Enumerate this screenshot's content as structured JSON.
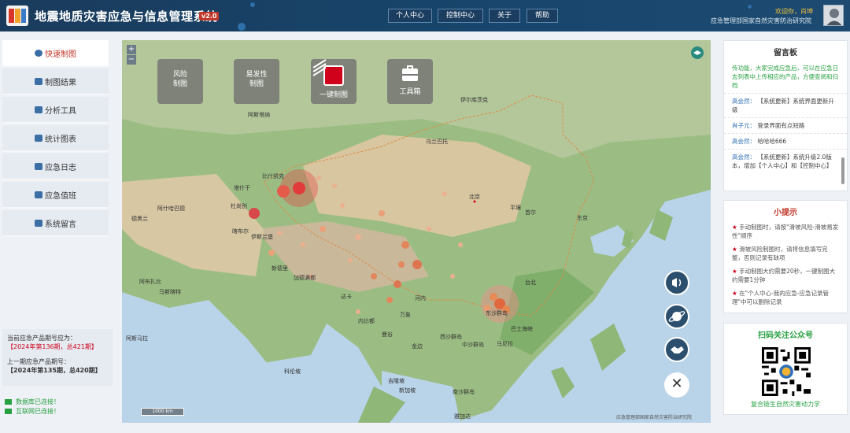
{
  "header": {
    "title": "地震地质灾害应急与信息管理系统",
    "version": "v2.0",
    "nav": [
      "个人中心",
      "控制中心",
      "关于",
      "帮助"
    ],
    "welcome": "欢迎你，肖坤",
    "org": "应急管理部国家自然灾害防治研究院"
  },
  "sidebar": {
    "items": [
      {
        "label": "快速制图",
        "active": true
      },
      {
        "label": "制图结果"
      },
      {
        "label": "分析工具"
      },
      {
        "label": "统计图表"
      },
      {
        "label": "应急日志"
      },
      {
        "label": "应急值班"
      },
      {
        "label": "系统留言"
      }
    ],
    "current_label": "当前应急产品期号应为：",
    "current_value": "【2024年第136期，总421期】",
    "previous_label": "上一期应急产品期号：",
    "previous_value": "【2024年第135期，总420期】",
    "status": [
      "数据库已连接！",
      "互联网已连接！"
    ]
  },
  "map": {
    "tools": [
      {
        "label": "风险\n制图",
        "icon": ""
      },
      {
        "label": "易发性\n制图",
        "icon": ""
      },
      {
        "label": "一键制图",
        "icon": "flag-icon"
      },
      {
        "label": "工具箱",
        "icon": "toolbox-icon"
      }
    ],
    "labels": [
      {
        "text": "阿斯塔纳",
        "name": "astana"
      },
      {
        "text": "比什凯克",
        "name": "bishkek"
      },
      {
        "text": "塔什干",
        "name": "tashkent"
      },
      {
        "text": "杜尚别",
        "name": "dushanbe"
      },
      {
        "text": "喀布尔",
        "name": "kabul"
      },
      {
        "text": "伊斯兰堡",
        "name": "islamabad"
      },
      {
        "text": "新德里",
        "name": "new-delhi"
      },
      {
        "text": "加德满都",
        "name": "kathmandu"
      },
      {
        "text": "达卡",
        "name": "dhaka"
      },
      {
        "text": "乌兰巴托",
        "name": "ulaanbaatar"
      },
      {
        "text": "北京",
        "name": "beijing"
      },
      {
        "text": "平壤",
        "name": "pyongyang"
      },
      {
        "text": "首尔",
        "name": "seoul"
      },
      {
        "text": "东京",
        "name": "tokyo"
      },
      {
        "text": "内比都",
        "name": "naypyidaw"
      },
      {
        "text": "万象",
        "name": "vientiane"
      },
      {
        "text": "河内",
        "name": "hanoi"
      },
      {
        "text": "曼谷",
        "name": "bangkok"
      },
      {
        "text": "金边",
        "name": "phnom-penh"
      },
      {
        "text": "马尼拉",
        "name": "manila"
      },
      {
        "text": "科伦坡",
        "name": "colombo"
      },
      {
        "text": "吉隆坡",
        "name": "kuala-lumpur"
      },
      {
        "text": "新加坡",
        "name": "singapore"
      },
      {
        "text": "雅加达",
        "name": "jakarta"
      },
      {
        "text": "阿什哈巴德",
        "name": "ashgabat"
      },
      {
        "text": "德黑兰",
        "name": "tehran"
      },
      {
        "text": "阿布扎比",
        "name": "abu-dhabi"
      },
      {
        "text": "马斯喀特",
        "name": "muscat"
      },
      {
        "text": "阿斯马拉",
        "name": "asmara"
      },
      {
        "text": "伊尔库茨克",
        "name": "irkutsk"
      },
      {
        "text": "南沙群岛",
        "name": "nansha"
      },
      {
        "text": "中沙群岛",
        "name": "zhongsha"
      },
      {
        "text": "西沙群岛",
        "name": "xisha"
      },
      {
        "text": "东沙群岛",
        "name": "dongsha"
      },
      {
        "text": "巴士海峡",
        "name": "bashi"
      },
      {
        "text": "台北",
        "name": "taipei"
      }
    ],
    "scale": "1000 km",
    "attribution": "应急管理部国家自然灾害防治研究院"
  },
  "message_board": {
    "title": "留言板",
    "intro": "传功能，大家完成应急后，可以在应急日志列表中上传相应的产品，方便查阅和归档",
    "entries": [
      {
        "name": "高会然：",
        "text": "【系统更新】系统界面更新升级"
      },
      {
        "name": "肖子元：",
        "text": "登录界面有点短路"
      },
      {
        "name": "高会然：",
        "text": "哈哈哈666"
      },
      {
        "name": "高会然：",
        "text": "【系统更新】系统升级2.0版本，增加【个人中心】和【控制中心】"
      }
    ]
  },
  "tips": {
    "title": "小提示",
    "items": [
      "手动制图时，请按\"滑坡风险-滑坡易发性\"顺序",
      "滑坡风险制图时，请将信息填写完整，否则记录有缺项",
      "手动制图大约需要20秒，一键制图大约需要1分钟",
      "在\"个人中心-我的应急-应急记录管理\"中可以删除记录"
    ]
  },
  "qr": {
    "title": "扫码关注公众号",
    "caption": "复合链生自然灾害动力学"
  },
  "colors": {
    "header_bg": "#1a3b5c",
    "accent_red": "#c0392b",
    "status_green": "#27a042"
  }
}
